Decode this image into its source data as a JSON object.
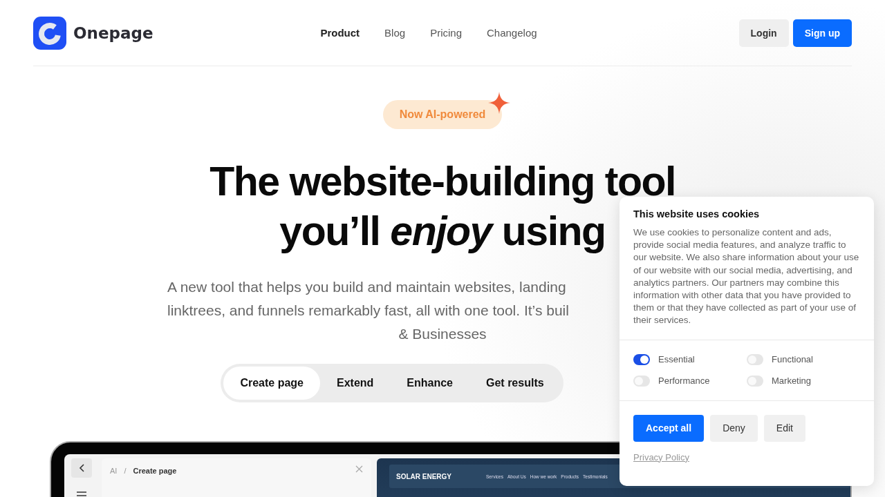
{
  "header": {
    "brand": "Onepage",
    "nav": [
      {
        "label": "Product",
        "selected": true
      },
      {
        "label": "Blog",
        "selected": false
      },
      {
        "label": "Pricing",
        "selected": false
      },
      {
        "label": "Changelog",
        "selected": false
      }
    ],
    "login": "Login",
    "signup": "Sign up"
  },
  "hero": {
    "badge": "Now AI-powered",
    "title_line_1": "The website-building tool",
    "title_line_2": "you’ll *enjoy* using",
    "subtitle_lines": [
      "A new tool that helps you build and maintain websites, landing",
      "linktrees, and funnels remarkably fast, all with one tool. It’s buil",
      "& Businesses"
    ],
    "tabs": [
      {
        "label": "Create page",
        "selected": true
      },
      {
        "label": "Extend",
        "selected": false
      },
      {
        "label": "Enhance",
        "selected": false
      },
      {
        "label": "Get results",
        "selected": false
      }
    ]
  },
  "mockup": {
    "breadcrumb_root": "AI",
    "breadcrumb_separator": "/",
    "breadcrumb_current": "Create page",
    "preview_brand": "SOLAR ENERGY",
    "preview_nav": [
      "Services",
      "About Us",
      "How we work",
      "Products",
      "Testimonials"
    ]
  },
  "cookie_dialog": {
    "title": "This website uses cookies",
    "text": "We use cookies to personalize content and ads, provide social media features, and analyze traffic to our website. We also share information about your use of our website with our social media, advertising, and analytics partners. Our partners may combine this information with other data that you have provided to them or that they have collected as part of your use of their services.",
    "options": [
      {
        "label": "Essential",
        "on": true
      },
      {
        "label": "Functional",
        "on": false
      },
      {
        "label": "Performance",
        "on": false
      },
      {
        "label": "Marketing",
        "on": false
      }
    ],
    "buttons": [
      {
        "label": "Accept all",
        "kind": "primary"
      },
      {
        "label": "Deny",
        "kind": "secondary"
      },
      {
        "label": "Edit",
        "kind": "secondary"
      }
    ],
    "privacy_link": "Privacy Policy"
  }
}
